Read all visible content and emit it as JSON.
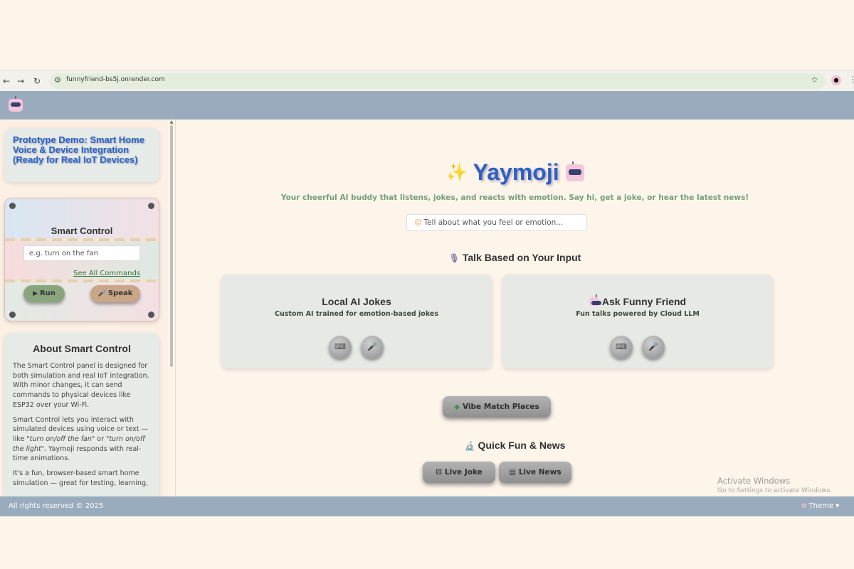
{
  "browser": {
    "url": "funnyfriend-bs5j.onrender.com",
    "icons": {
      "back": "back-arrow-icon",
      "forward": "forward-arrow-icon",
      "reload": "reload-icon",
      "site_info": "tune-icon",
      "bookmark": "star-icon",
      "profile": "profile-icon",
      "menu": "more-vert-icon"
    }
  },
  "header": {
    "logo_icon": "robot-icon"
  },
  "sidebar": {
    "prototype_title": "Prototype Demo: Smart Home Voice & Device Integration (Ready for Real IoT Devices)",
    "smart_control": {
      "title": "Smart Control",
      "input_placeholder": "e.g. turn on the fan",
      "see_all_label": "See All Commands",
      "run_label": "Run",
      "speak_label": "Speak"
    },
    "about": {
      "title": "About Smart Control",
      "p1": "The Smart Control panel is designed for both simulation and real IoT integration. With minor changes, it can send commands to physical devices like ESP32 over your Wi-Fi.",
      "p2_a": "Smart Control lets you interact with simulated devices using voice or text — like ",
      "p2_em1": "\"turn on/off the fan\"",
      "p2_b": " or ",
      "p2_em2": "\"turn on/off the light\"",
      "p2_c": ". Yaymoji responds with real-time animations.",
      "p3": "It's a fun, browser-based smart home simulation — great for testing, learning,"
    }
  },
  "main": {
    "title": "Yaymoji",
    "tagline": "Your cheerful AI buddy that listens, jokes, and reacts with emotion. Say hi, get a joke, or hear the latest news!",
    "feel_placeholder": "Tell about what you feel or emotion...",
    "talk_heading": "Talk Based on Your Input",
    "cards": [
      {
        "title": "Local AI Jokes",
        "subtitle": "Custom AI trained for emotion-based jokes"
      },
      {
        "title": "Ask Funny Friend",
        "subtitle": "Fun talks powered by Cloud LLM"
      }
    ],
    "vibe_label": "Vibe Match Places",
    "quick_heading": "Quick Fun & News",
    "live_joke_label": "Live Joke",
    "live_news_label": "Live News"
  },
  "watermark": {
    "line1": "Activate Windows",
    "line2": "Go to Settings to activate Windows."
  },
  "footer": {
    "copyright": "All rights reserved © 2025",
    "theme_label": "Theme"
  }
}
